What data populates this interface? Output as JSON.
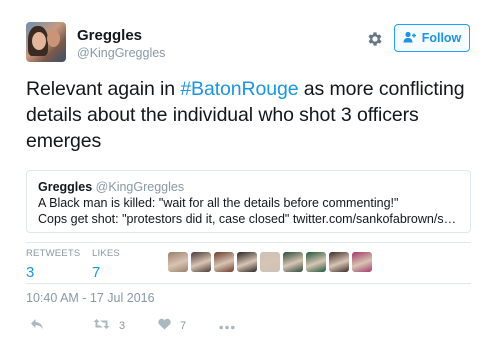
{
  "user": {
    "name": "Greggles",
    "handle": "@KingGreggles"
  },
  "follow_button": {
    "label": "Follow",
    "icon": "add-user-icon"
  },
  "settings_icon": "gear-icon",
  "tweet": {
    "text_before": "Relevant again in ",
    "hashtag": "#BatonRouge",
    "text_after": " as more conflicting details about the individual who shot 3 officers emerges"
  },
  "quoted_tweet": {
    "name": "Greggles",
    "handle": "@KingGreggles",
    "line1": "A Black man is killed: \"wait for all the details before commenting!\"",
    "line2": "Cops get shot: \"protestors did it, case closed\" twitter.com/sankofabrown/s…"
  },
  "stats": {
    "retweets_label": "RETWEETS",
    "retweets_count": "3",
    "likes_label": "LIKES",
    "likes_count": "7"
  },
  "likers": [
    {
      "color": "#9a7f6a"
    },
    {
      "color": "#4a3a34"
    },
    {
      "color": "#6b3b2c"
    },
    {
      "color": "#2a2424"
    },
    {
      "color": "#c9c2bb"
    },
    {
      "color": "#2d4a3a"
    },
    {
      "color": "#1f5a3a"
    },
    {
      "color": "#3a2c28"
    },
    {
      "color": "#a03a6a"
    }
  ],
  "timestamp": "10:40 AM - 17 Jul 2016",
  "actions": {
    "reply_icon": "reply-icon",
    "retweet_icon": "retweet-icon",
    "retweet_count": "3",
    "like_icon": "heart-icon",
    "like_count": "7",
    "more_icon": "more-icon"
  },
  "colors": {
    "accent": "#1b95e0",
    "muted": "#8899a6",
    "border": "#e1e8ed"
  }
}
